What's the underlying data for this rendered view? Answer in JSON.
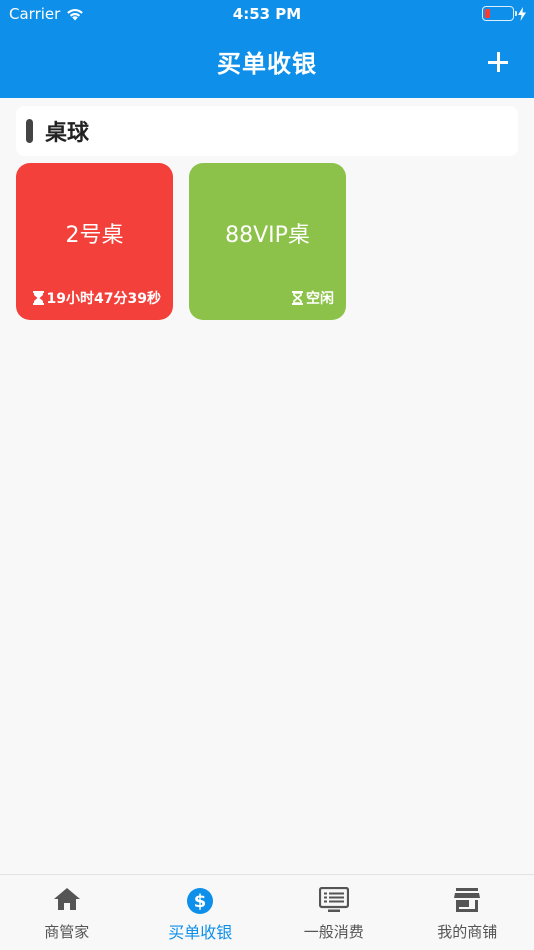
{
  "status_bar": {
    "carrier": "Carrier",
    "time": "4:53 PM",
    "battery_color": "#ff3b30"
  },
  "navbar": {
    "title": "买单收银",
    "add_icon": "plus-icon",
    "background": "#0e8fe9"
  },
  "section": {
    "title": "桌球"
  },
  "tables": [
    {
      "name": "2号桌",
      "status": "19小时47分39秒",
      "status_icon": "hourglass-filled-icon",
      "color": "#f4403a"
    },
    {
      "name": "88VIP桌",
      "status": "空闲",
      "status_icon": "hourglass-empty-icon",
      "color": "#8dc24a"
    }
  ],
  "tabbar": {
    "items": [
      {
        "label": "商管家",
        "icon": "home-icon",
        "active": false
      },
      {
        "label": "买单收银",
        "icon": "dollar-icon",
        "active": true
      },
      {
        "label": "一般消费",
        "icon": "list-monitor-icon",
        "active": false
      },
      {
        "label": "我的商铺",
        "icon": "store-icon",
        "active": false
      }
    ],
    "active_color": "#0e8fe9"
  }
}
